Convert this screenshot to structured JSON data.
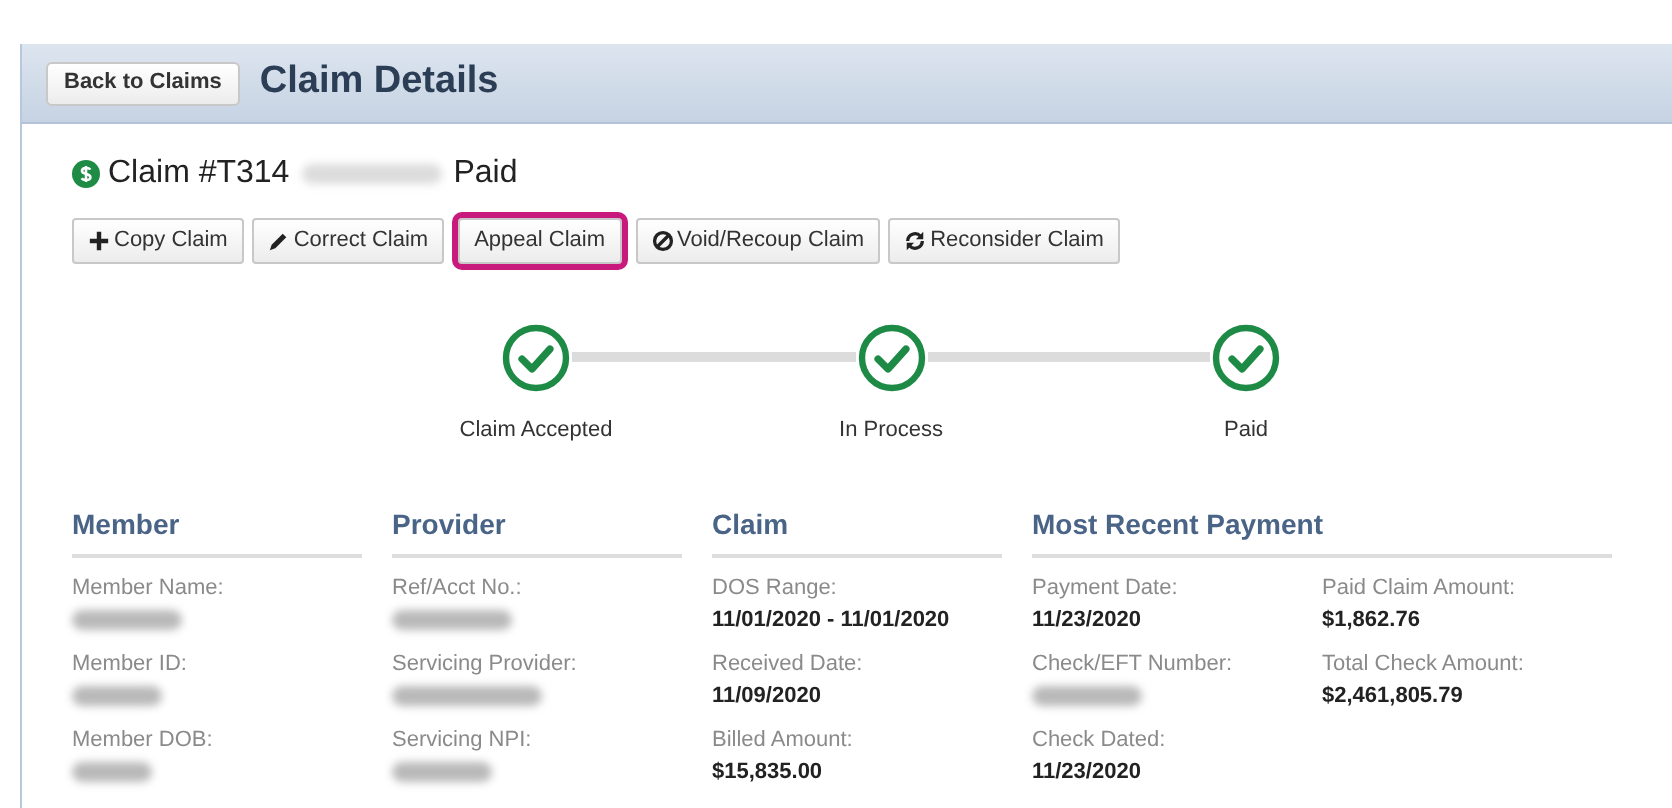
{
  "header": {
    "back_button": "Back to Claims",
    "title": "Claim Details"
  },
  "claim": {
    "prefix": "Claim #T314",
    "number_redacted": true,
    "status": "Paid"
  },
  "actions": [
    {
      "label": "Copy Claim",
      "kind": "copy",
      "highlighted": false
    },
    {
      "label": "Correct Claim",
      "kind": "correct",
      "highlighted": false
    },
    {
      "label": "Appeal Claim",
      "kind": "appeal",
      "highlighted": true
    },
    {
      "label": "Void/Recoup Claim",
      "kind": "void",
      "highlighted": false
    },
    {
      "label": "Reconsider Claim",
      "kind": "reconsider",
      "highlighted": false
    }
  ],
  "steps": [
    {
      "label": "Claim Accepted",
      "done": true
    },
    {
      "label": "In Process",
      "done": true
    },
    {
      "label": "Paid",
      "done": true
    }
  ],
  "sections": [
    {
      "title": "Member",
      "columns": [
        [
          {
            "label": "Member Name:",
            "kind": "redacted"
          },
          {
            "label": "Member ID:",
            "kind": "redacted"
          },
          {
            "label": "Member DOB:",
            "kind": "redacted"
          }
        ]
      ]
    },
    {
      "title": "Provider",
      "columns": [
        [
          {
            "label": "Ref/Acct No.:",
            "kind": "redacted"
          },
          {
            "label": "Servicing Provider:",
            "kind": "redacted"
          },
          {
            "label": "Servicing NPI:",
            "kind": "redacted"
          }
        ]
      ]
    },
    {
      "title": "Claim",
      "columns": [
        [
          {
            "label": "DOS Range:",
            "kind": "text",
            "value": "11/01/2020 - 11/01/2020"
          },
          {
            "label": "Received Date:",
            "kind": "text",
            "value": "11/09/2020"
          },
          {
            "label": "Billed Amount:",
            "kind": "text",
            "value": "$15,835.00"
          }
        ]
      ]
    },
    {
      "title": "Most Recent Payment",
      "columns": [
        [
          {
            "label": "Payment Date:",
            "kind": "text",
            "value": "11/23/2020"
          },
          {
            "label": "Check/EFT Number:",
            "kind": "redacted"
          },
          {
            "label": "Check Dated:",
            "kind": "text",
            "value": "11/23/2020"
          }
        ],
        [
          {
            "label": "Paid Claim Amount:",
            "kind": "text",
            "value": "$1,862.76"
          },
          {
            "label": "Total Check Amount:",
            "kind": "text",
            "value": "$2,461,805.79"
          }
        ]
      ]
    }
  ]
}
